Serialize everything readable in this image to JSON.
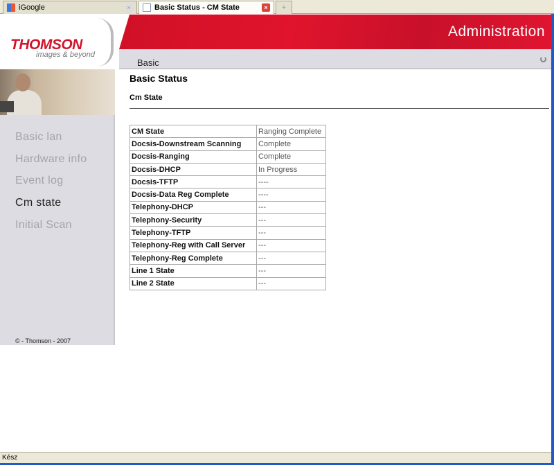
{
  "browser": {
    "tabs": [
      {
        "label": "iGoogle",
        "active": false
      },
      {
        "label": "Basic Status - CM State",
        "active": true
      }
    ],
    "new_tab_icon": "plus-icon",
    "status_text": "Kész"
  },
  "header": {
    "brand": "THOMSON",
    "tagline": "images & beyond",
    "section_title": "Administration",
    "nav_item": "Basic"
  },
  "sidebar": {
    "items": [
      {
        "label": "Basic lan"
      },
      {
        "label": "Hardware info"
      },
      {
        "label": "Event log"
      },
      {
        "label": "Cm state",
        "active": true
      },
      {
        "label": "Initial Scan"
      }
    ],
    "copyright": "© - Thomson - 2007"
  },
  "main": {
    "title": "Basic Status",
    "subtitle": "Cm State",
    "rows": [
      {
        "key": "CM State",
        "value": "Ranging Complete"
      },
      {
        "key": "Docsis-Downstream Scanning",
        "value": "Complete"
      },
      {
        "key": "Docsis-Ranging",
        "value": "Complete"
      },
      {
        "key": "Docsis-DHCP",
        "value": "In Progress"
      },
      {
        "key": "Docsis-TFTP",
        "value": "----"
      },
      {
        "key": "Docsis-Data Reg Complete",
        "value": "----"
      },
      {
        "key": "Telephony-DHCP",
        "value": "---"
      },
      {
        "key": "Telephony-Security",
        "value": "---"
      },
      {
        "key": "Telephony-TFTP",
        "value": "---"
      },
      {
        "key": "Telephony-Reg with Call Server",
        "value": "---"
      },
      {
        "key": "Telephony-Reg Complete",
        "value": "---"
      },
      {
        "key": "Line 1 State",
        "value": "---"
      },
      {
        "key": "Line 2 State",
        "value": "---"
      }
    ]
  },
  "colors": {
    "brand_red": "#d0142b",
    "sidebar_bg": "#dcdce2"
  }
}
